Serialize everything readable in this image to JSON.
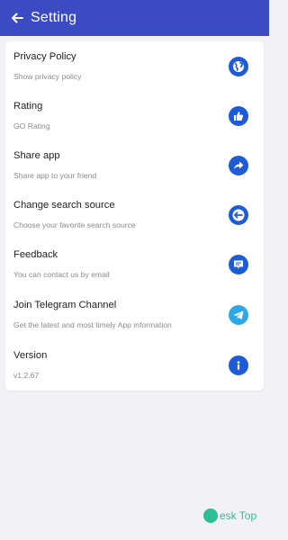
{
  "app_bar": {
    "title": "Setting",
    "color": "#3a4bc4"
  },
  "settings": [
    {
      "title": "Privacy Policy",
      "subtitle": "Show privacy policy",
      "icon": "globe-icon"
    },
    {
      "title": "Rating",
      "subtitle": "GO Rating",
      "icon": "thumbs-up-icon"
    },
    {
      "title": "Share app",
      "subtitle": "Share app to your friend",
      "icon": "share-arrow-icon"
    },
    {
      "title": "Change search source",
      "subtitle": "Choose your favorite search source",
      "icon": "swap-icon"
    },
    {
      "title": "Feedback",
      "subtitle": "You can contact us by email",
      "icon": "message-icon"
    },
    {
      "title": "Join Telegram Channel",
      "subtitle": "Get the latest and most timely App information",
      "icon": "telegram-icon"
    },
    {
      "title": "Version",
      "subtitle": "v1.2.67",
      "icon": "info-icon"
    }
  ],
  "colors": {
    "icon_blue": "#1e5bd6",
    "telegram_blue": "#2da8e6",
    "background": "#f2f2f6"
  },
  "watermark": {
    "text": "esk Top"
  }
}
